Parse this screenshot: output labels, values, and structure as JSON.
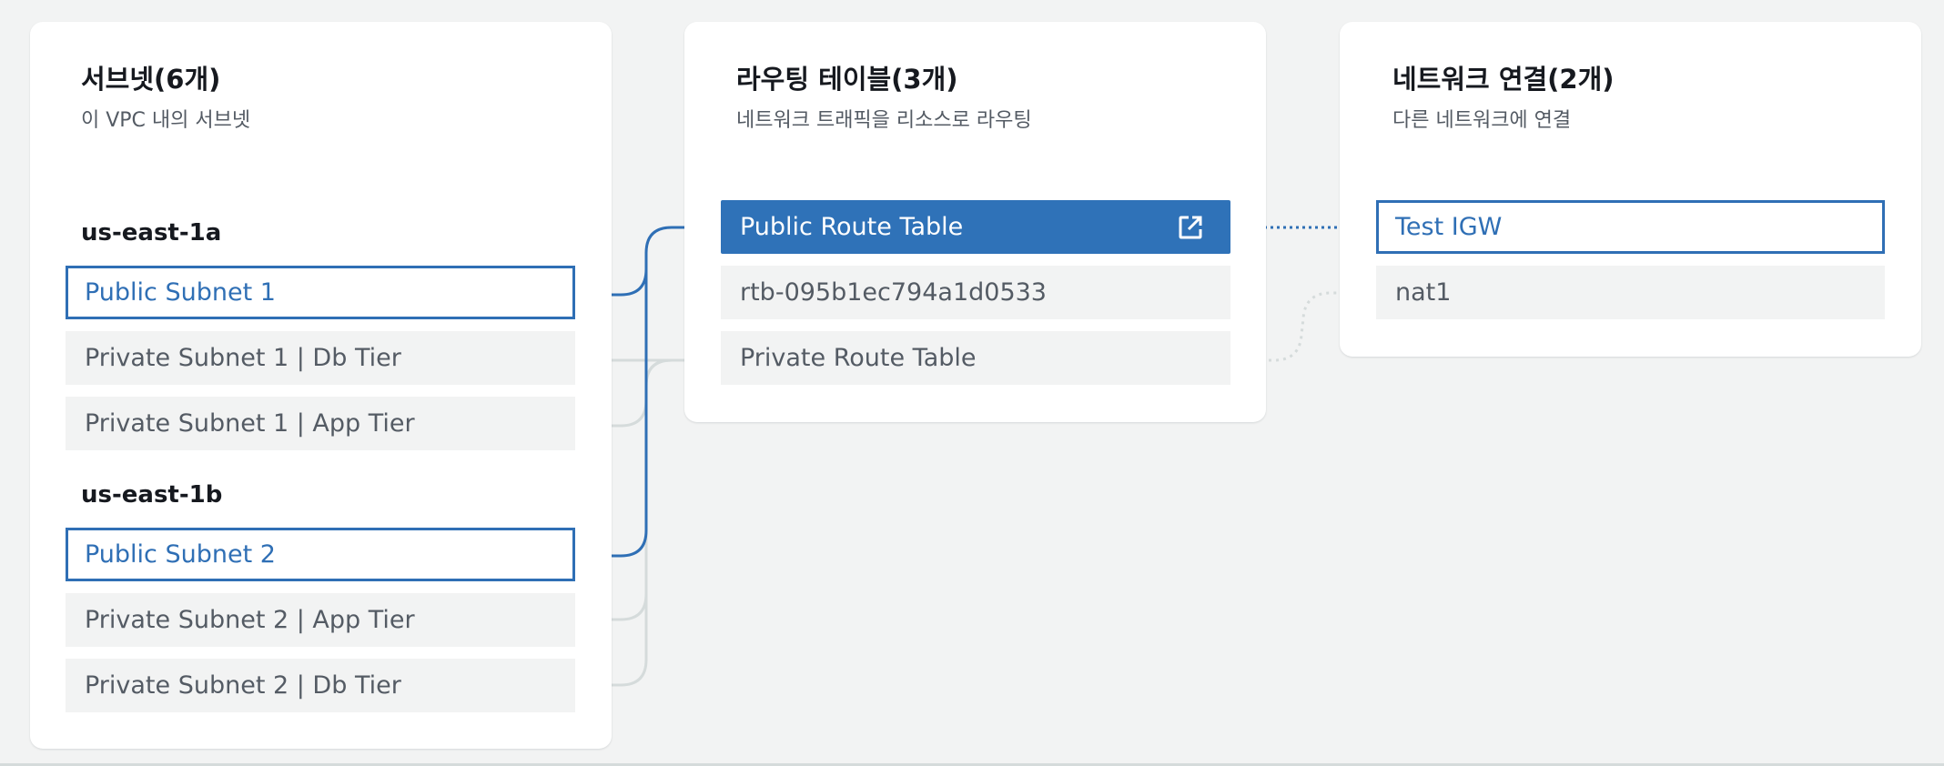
{
  "subnets_panel": {
    "title": "서브넷(6개)",
    "subtitle": "이 VPC 내의 서브넷",
    "zones": [
      {
        "name": "us-east-1a",
        "subnets": [
          "Public Subnet 1",
          "Private Subnet 1 | Db Tier",
          "Private Subnet 1 | App Tier"
        ]
      },
      {
        "name": "us-east-1b",
        "subnets": [
          "Public Subnet 2",
          "Private Subnet 2 | App Tier",
          "Private Subnet 2 | Db Tier"
        ]
      }
    ]
  },
  "route_tables_panel": {
    "title": "라우팅 테이블(3개)",
    "subtitle": "네트워크 트래픽을 리소스로 라우팅",
    "items": [
      "Public Route Table",
      "rtb-095b1ec794a1d0533",
      "Private Route Table"
    ],
    "open_icon": "external-link-icon"
  },
  "connections_panel": {
    "title": "네트워크 연결(2개)",
    "subtitle": "다른 네트워크에 연결",
    "items": [
      "Test IGW",
      "nat1"
    ]
  },
  "colors": {
    "background": "#f2f3f3",
    "panel": "#ffffff",
    "accent": "#2f72b8",
    "selected_border": "#2f6fb5",
    "item_background": "#f2f3f3",
    "inactive_link": "#d5dbdb"
  }
}
